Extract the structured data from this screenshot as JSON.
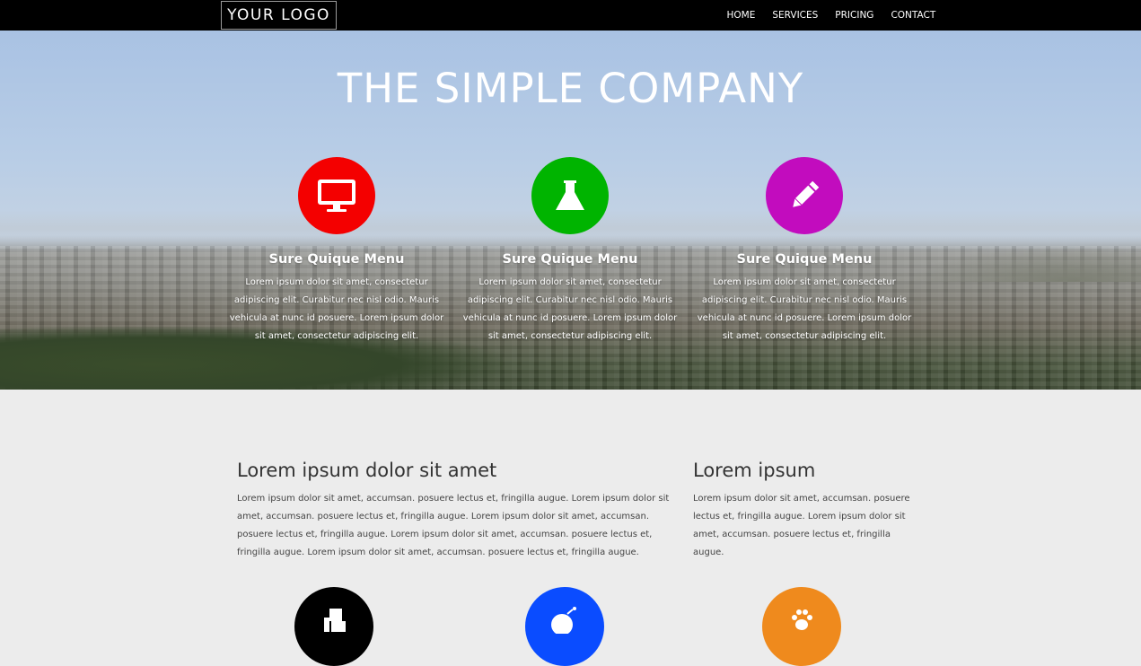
{
  "navbar": {
    "logo": "YOUR LOGO",
    "links": [
      "HOME",
      "SERVICES",
      "PRICING",
      "CONTACT"
    ]
  },
  "hero": {
    "title": "THE SIMPLE COMPANY",
    "features": [
      {
        "icon": "monitor-icon",
        "color": "#f40000",
        "title": "Sure Quique Menu",
        "text": "Lorem ipsum dolor sit amet, consectetur adipiscing elit. Curabitur nec nisl odio. Mauris vehicula at nunc id posuere. Lorem ipsum dolor sit amet, consectetur adipiscing elit."
      },
      {
        "icon": "flask-icon",
        "color": "#00b400",
        "title": "Sure Quique Menu",
        "text": "Lorem ipsum dolor sit amet, consectetur adipiscing elit. Curabitur nec nisl odio. Mauris vehicula at nunc id posuere. Lorem ipsum dolor sit amet, consectetur adipiscing elit."
      },
      {
        "icon": "pencil-icon",
        "color": "#c20cbe",
        "title": "Sure Quique Menu",
        "text": "Lorem ipsum dolor sit amet, consectetur adipiscing elit. Curabitur nec nisl odio. Mauris vehicula at nunc id posuere. Lorem ipsum dolor sit amet, consectetur adipiscing elit."
      }
    ]
  },
  "content": {
    "left": {
      "heading": "Lorem ipsum dolor sit amet",
      "text": "Lorem ipsum dolor sit amet, accumsan. posuere lectus et, fringilla augue. Lorem ipsum dolor sit amet, accumsan. posuere lectus et, fringilla augue. Lorem ipsum dolor sit amet, accumsan. posuere lectus et, fringilla augue. Lorem ipsum dolor sit amet, accumsan. posuere lectus et, fringilla augue. Lorem ipsum dolor sit amet, accumsan. posuere lectus et, fringilla augue."
    },
    "right": {
      "heading": "Lorem ipsum",
      "text": "Lorem ipsum dolor sit amet, accumsan. posuere lectus et, fringilla augue. Lorem ipsum dolor sit amet, accumsan. posuere lectus et, fringilla augue."
    }
  },
  "bottom_icons": [
    {
      "icon": "fax-icon",
      "color": "#000000"
    },
    {
      "icon": "bomb-icon",
      "color": "#0a4cff"
    },
    {
      "icon": "paw-icon",
      "color": "#ef8a1d"
    }
  ]
}
